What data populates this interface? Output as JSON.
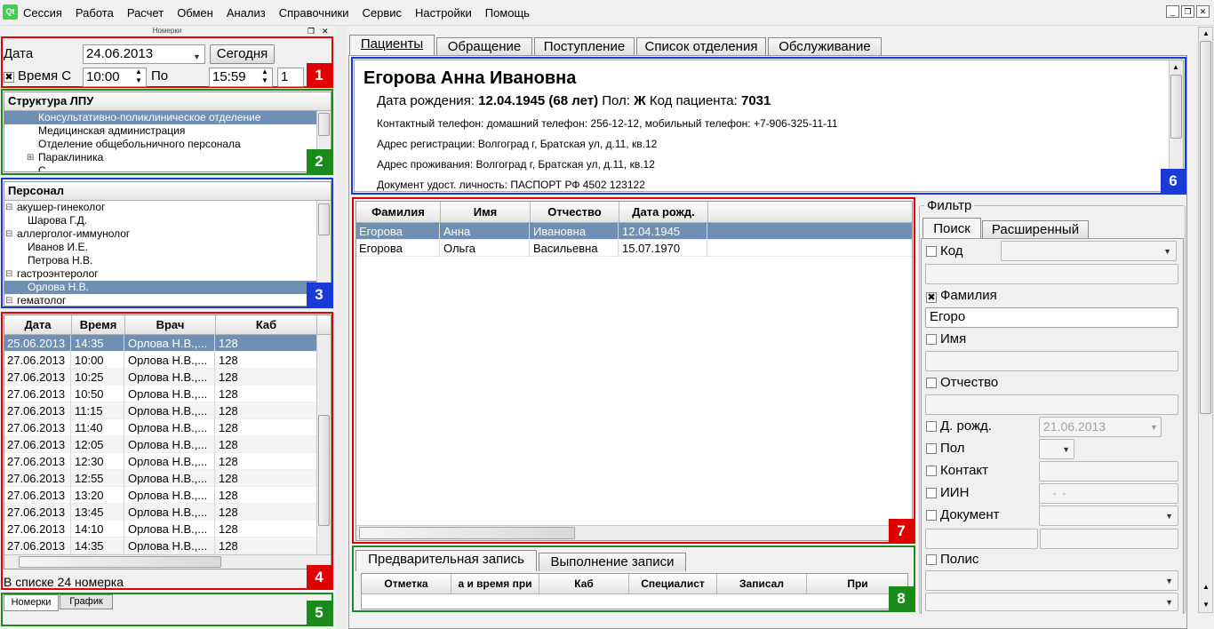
{
  "app": {
    "logo": "Qt"
  },
  "menu": [
    "Сессия",
    "Работа",
    "Расчет",
    "Обмен",
    "Анализ",
    "Справочники",
    "Сервис",
    "Настройки",
    "Помощь"
  ],
  "panel_title": "Номерки",
  "date_filter": {
    "date_label": "Дата",
    "date_value": "24.06.2013",
    "today_button": "Сегодня",
    "time_label": "Время С",
    "time_from": "10:00",
    "to_label": "По",
    "time_to": "15:59",
    "count": "1",
    "time_checked": "✖"
  },
  "structure": {
    "header": "Структура ЛПУ",
    "items": [
      "Консультативно-поликлиническое отделение",
      "Медицинская администрация",
      "Отделение общебольничного персонала",
      "Параклиника",
      "С..."
    ]
  },
  "personnel": {
    "header": "Персонал",
    "items": [
      {
        "text": "акушер-гинеколог",
        "level": 0,
        "selected": false
      },
      {
        "text": "Шарова Г.Д.",
        "level": 1,
        "selected": false
      },
      {
        "text": "аллерголог-иммунолог",
        "level": 0,
        "selected": false
      },
      {
        "text": "Иванов И.Е.",
        "level": 1,
        "selected": false
      },
      {
        "text": "Петрова Н.В.",
        "level": 1,
        "selected": false
      },
      {
        "text": "гастроэнтеролог",
        "level": 0,
        "selected": false
      },
      {
        "text": "Орлова Н.В.",
        "level": 1,
        "selected": true
      },
      {
        "text": "гематолог",
        "level": 0,
        "selected": false
      }
    ]
  },
  "slots": {
    "columns": [
      "Дата",
      "Время",
      "Врач",
      "Каб"
    ],
    "rows": [
      [
        "25.06.2013",
        "14:35",
        "Орлова Н.В.,...",
        "128"
      ],
      [
        "27.06.2013",
        "10:00",
        "Орлова Н.В.,...",
        "128"
      ],
      [
        "27.06.2013",
        "10:25",
        "Орлова Н.В.,...",
        "128"
      ],
      [
        "27.06.2013",
        "10:50",
        "Орлова Н.В.,...",
        "128"
      ],
      [
        "27.06.2013",
        "11:15",
        "Орлова Н.В.,...",
        "128"
      ],
      [
        "27.06.2013",
        "11:40",
        "Орлова Н.В.,...",
        "128"
      ],
      [
        "27.06.2013",
        "12:05",
        "Орлова Н.В.,...",
        "128"
      ],
      [
        "27.06.2013",
        "12:30",
        "Орлова Н.В.,...",
        "128"
      ],
      [
        "27.06.2013",
        "12:55",
        "Орлова Н.В.,...",
        "128"
      ],
      [
        "27.06.2013",
        "13:20",
        "Орлова Н.В.,...",
        "128"
      ],
      [
        "27.06.2013",
        "13:45",
        "Орлова Н.В.,...",
        "128"
      ],
      [
        "27.06.2013",
        "14:10",
        "Орлова Н.В.,...",
        "128"
      ],
      [
        "27.06.2013",
        "14:35",
        "Орлова Н.В.,...",
        "128"
      ]
    ],
    "status": "В списке 24 номерка"
  },
  "bottom_tabs": [
    "Номерки",
    "График"
  ],
  "main_tabs": [
    "Пациенты",
    "Обращение",
    "Поступление",
    "Список отделения",
    "Обслуживание"
  ],
  "patient": {
    "name": "Егорова Анна Ивановна",
    "birth_label": "Дата рождения:",
    "birth_value": "12.04.1945 (68 лет)",
    "sex_label": "Пол:",
    "sex_value": "Ж",
    "code_label": "Код пациента:",
    "code_value": "7031",
    "phone": "Контактный телефон: домашний телефон: 256-12-12, мобильный телефон: +7-906-325-11-11",
    "reg_address": "Адрес регистрации: Волгоград г, Братская ул, д.11, кв.12",
    "live_address": "Адрес проживания: Волгоград г, Братская ул, д.11, кв.12",
    "document": "Документ удост. личность: ПАСПОРТ РФ 4502 123122"
  },
  "patients_table": {
    "columns": [
      "Фамилия",
      "Имя",
      "Отчество",
      "Дата рожд."
    ],
    "rows": [
      [
        "Егорова",
        "Анна",
        "Ивановна",
        "12.04.1945"
      ],
      [
        "Егорова",
        "Ольга",
        "Васильевна",
        "15.07.1970"
      ]
    ]
  },
  "record_tabs": [
    "Предварительная запись",
    "Выполнение записи"
  ],
  "record_columns": [
    "Отметка",
    "а и время при",
    "Каб",
    "Специалист",
    "Записал",
    "При"
  ],
  "filter": {
    "title": "Фильтр",
    "tabs": [
      "Поиск",
      "Расширенный"
    ],
    "code_label": "Код",
    "surname_label": "Фамилия",
    "surname_value": "Егоро",
    "surname_checked": "✖",
    "name_label": "Имя",
    "patronymic_label": "Отчество",
    "birth_label": "Д. рожд.",
    "birth_value": "21.06.2013",
    "sex_label": "Пол",
    "contact_label": "Контакт",
    "iin_label": "ИИН",
    "iin_value": "  -  -",
    "document_label": "Документ",
    "policy_label": "Полис"
  },
  "markers": [
    "1",
    "2",
    "3",
    "4",
    "5",
    "6",
    "7",
    "8"
  ],
  "colors": {
    "selection": "#6f8fb4",
    "red": "#e00000",
    "green": "#1a8a1a",
    "blue": "#1a3ad8"
  }
}
